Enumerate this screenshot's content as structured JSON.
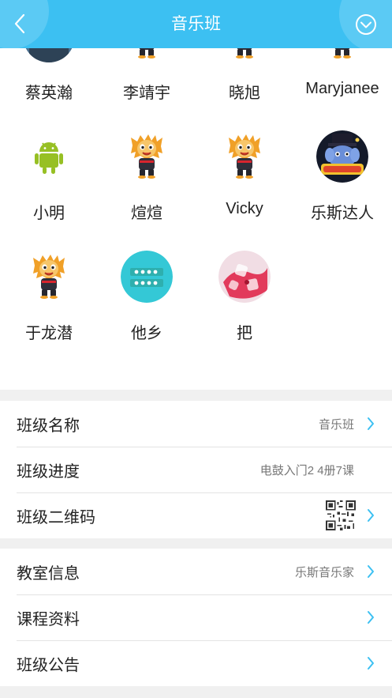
{
  "header": {
    "title": "音乐班",
    "bg": "#3cc0f2"
  },
  "members": [
    {
      "name": "蔡英瀚",
      "avatar": "photo-man"
    },
    {
      "name": "李靖宇",
      "avatar": "lion-mascot"
    },
    {
      "name": "晓旭",
      "avatar": "lion-mascot"
    },
    {
      "name": "Maryjanee",
      "avatar": "lion-mascot"
    },
    {
      "name": "小明",
      "avatar": "android-robot"
    },
    {
      "name": "煊煊",
      "avatar": "lion-mascot"
    },
    {
      "name": "Vicky",
      "avatar": "lion-mascot"
    },
    {
      "name": "乐斯达人",
      "avatar": "elephant-magician"
    },
    {
      "name": "于龙潜",
      "avatar": "lion-mascot"
    },
    {
      "name": "他乡",
      "avatar": "teal-dots"
    },
    {
      "name": "把",
      "avatar": "red-ice"
    }
  ],
  "class_info": {
    "name_label": "班级名称",
    "name_value": "音乐班",
    "progress_label": "班级进度",
    "progress_value": "电鼓入门2 4册7课",
    "qrcode_label": "班级二维码"
  },
  "extra": {
    "classroom_label": "教室信息",
    "classroom_value": "乐斯音乐家",
    "materials_label": "课程资料",
    "notice_label": "班级公告"
  },
  "accent": "#3cc0f2"
}
